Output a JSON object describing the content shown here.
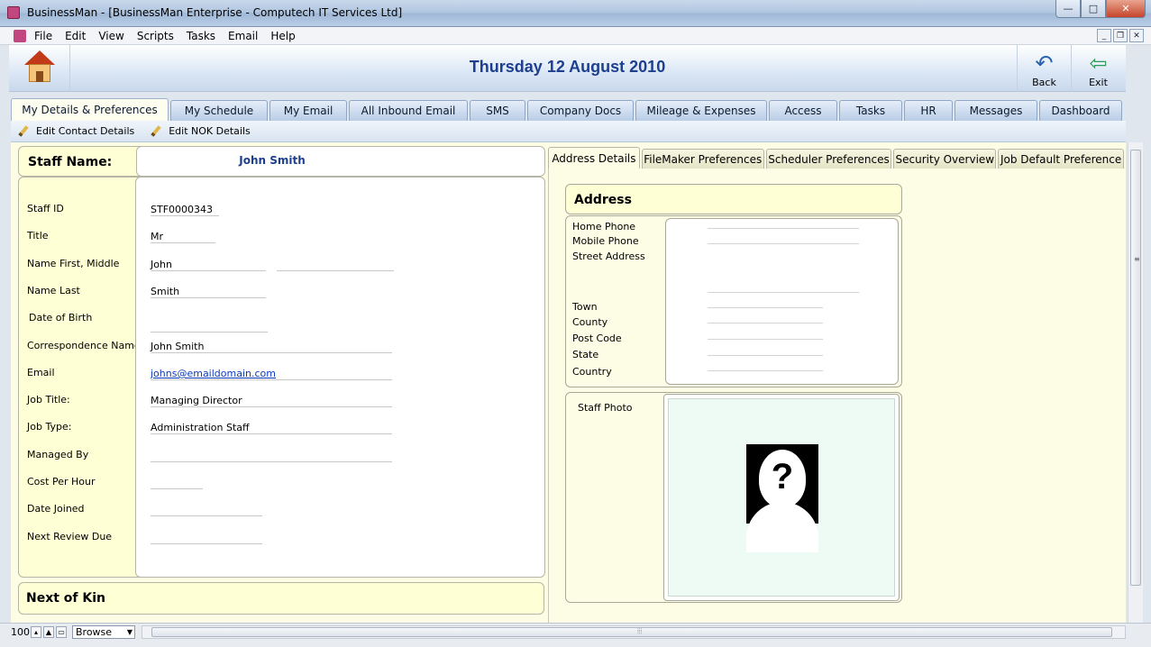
{
  "window": {
    "title": "BusinessMan - [BusinessMan Enterprise -  Computech IT Services Ltd]",
    "min_glyph": "—",
    "max_glyph": "□",
    "close_glyph": "✕"
  },
  "menu": {
    "items": [
      "File",
      "Edit",
      "View",
      "Scripts",
      "Tasks",
      "Email",
      "Help"
    ],
    "mdi": [
      "_",
      "❐",
      "✕"
    ]
  },
  "header": {
    "date": "Thursday 12 August 2010",
    "back_label": "Back",
    "exit_label": "Exit"
  },
  "main_tabs": [
    {
      "label": "My Details & Preferences",
      "active": true
    },
    {
      "label": "My Schedule"
    },
    {
      "label": "My Email"
    },
    {
      "label": "All Inbound Email"
    },
    {
      "label": "SMS"
    },
    {
      "label": "Company Docs"
    },
    {
      "label": "Mileage & Expenses"
    },
    {
      "label": "Access"
    },
    {
      "label": "Tasks"
    },
    {
      "label": "HR"
    },
    {
      "label": "Messages"
    },
    {
      "label": "Dashboard"
    }
  ],
  "subtoolbar": {
    "edit_contact": "Edit Contact Details",
    "edit_nok": "Edit NOK Details"
  },
  "staff": {
    "name_label": "Staff Name:",
    "name_value": "John Smith",
    "fields": [
      {
        "label": "Staff ID",
        "value": "STF0000343"
      },
      {
        "label": "Title",
        "value": "Mr"
      },
      {
        "label": "Name First, Middle",
        "value": "John",
        "value2": ""
      },
      {
        "label": "Name Last",
        "value": "Smith"
      },
      {
        "label": "Date of Birth",
        "value": ""
      },
      {
        "label": "Correspondence Name",
        "value": "John Smith"
      },
      {
        "label": "Email",
        "value": "johns@emaildomain.com"
      },
      {
        "label": "Job Title:",
        "value": "Managing Director"
      },
      {
        "label": "Job Type:",
        "value": "Administration Staff"
      },
      {
        "label": "Managed By",
        "value": ""
      },
      {
        "label": "Cost Per Hour",
        "value": ""
      },
      {
        "label": "Date Joined",
        "value": ""
      },
      {
        "label": "Next Review Due",
        "value": ""
      }
    ],
    "nok_title": "Next of Kin"
  },
  "right_tabs": [
    {
      "label": "Address Details",
      "active": true
    },
    {
      "label": "FileMaker Preferences"
    },
    {
      "label": "Scheduler Preferences"
    },
    {
      "label": "Security Overview"
    },
    {
      "label": "Job Default Preference"
    }
  ],
  "address": {
    "title": "Address",
    "labels": [
      "Home Phone",
      "Mobile Phone",
      "Street Address",
      "Town",
      "County",
      "Post Code",
      "State",
      "Country"
    ]
  },
  "photo": {
    "label": "Staff Photo",
    "placeholder_glyph": "?"
  },
  "status": {
    "zoom": "100",
    "mode": "Browse"
  }
}
